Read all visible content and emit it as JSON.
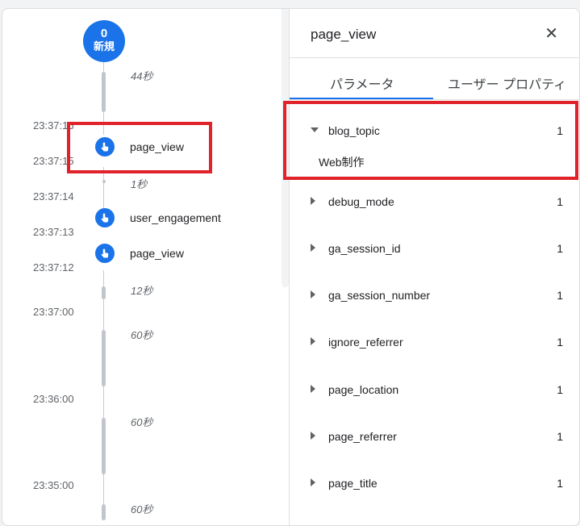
{
  "timeline": {
    "new_count": "0",
    "new_label": "新規",
    "times": [
      "23:37:16",
      "23:37:15",
      "23:37:14",
      "23:37:13",
      "23:37:12",
      "23:37:00",
      "23:36:00",
      "23:35:00"
    ],
    "durations": [
      "44秒",
      "1秒",
      "12秒",
      "60秒",
      "60秒",
      "60秒"
    ],
    "events": [
      "page_view",
      "user_engagement",
      "page_view"
    ]
  },
  "panel": {
    "title": "page_view",
    "close_icon": "close-icon",
    "tabs": [
      "パラメータ",
      "ユーザー プロパティ"
    ],
    "active_tab": 0,
    "params": [
      {
        "name": "blog_topic",
        "count": "1",
        "expanded": true,
        "value": "Web制作"
      },
      {
        "name": "debug_mode",
        "count": "1"
      },
      {
        "name": "ga_session_id",
        "count": "1"
      },
      {
        "name": "ga_session_number",
        "count": "1"
      },
      {
        "name": "ignore_referrer",
        "count": "1"
      },
      {
        "name": "page_location",
        "count": "1"
      },
      {
        "name": "page_referrer",
        "count": "1"
      },
      {
        "name": "page_title",
        "count": "1"
      }
    ]
  },
  "colors": {
    "accent": "#1a73e8",
    "highlight": "#e0222a"
  }
}
